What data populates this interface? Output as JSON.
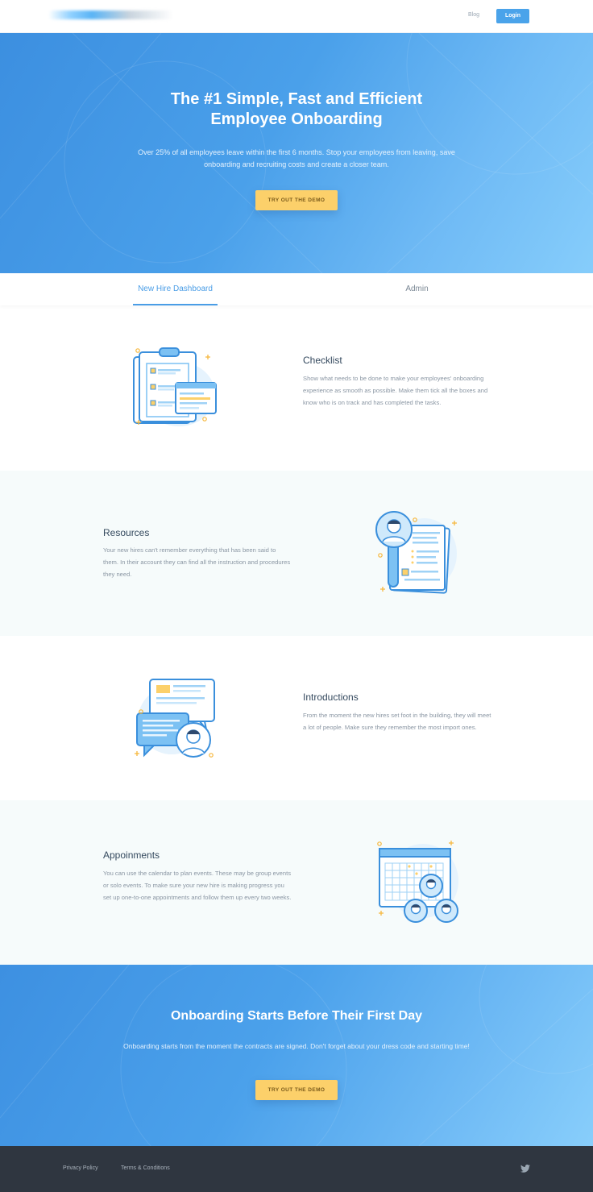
{
  "nav": {
    "blog": "Blog",
    "login": "Login"
  },
  "hero": {
    "title_line1": "The #1 Simple, Fast and Efficient",
    "title_line2": "Employee Onboarding",
    "subtitle": "Over 25% of all employees leave within the first 6 months. Stop your employees from leaving, save onboarding and recruiting costs and create a closer team.",
    "cta": "TRY OUT THE DEMO"
  },
  "tabs": [
    {
      "label": "New Hire Dashboard",
      "active": true
    },
    {
      "label": "Admin",
      "active": false
    }
  ],
  "features": [
    {
      "title": "Checklist",
      "text": "Show what needs to be done to make your employees' onboarding experience as smooth as possible. Make them tick all the boxes and know who is on track and has completed the tasks.",
      "icon": "clipboard-checklist-icon"
    },
    {
      "title": "Resources",
      "text": "Your new hires can't remember everything that has been said to them. In their account they can find all the instruction  and procedures they need.",
      "icon": "resources-document-icon"
    },
    {
      "title": "Introductions",
      "text": "From the moment the new hires set foot in the building, they will meet a lot of people. Make sure they remember the most import ones.",
      "icon": "chat-introductions-icon"
    },
    {
      "title": "Appoinments",
      "text": "You can use the calendar to plan events. These may be group events or solo events. To make sure your new hire is making progress you set up one-to-one appointments and follow them up every two weeks.",
      "icon": "calendar-appointments-icon"
    }
  ],
  "bottom_cta": {
    "title": "Onboarding Starts Before Their First Day",
    "subtitle": "Onboarding starts from the moment the contracts are signed. Don't forget about your dress code and starting time!",
    "cta": "TRY OUT THE DEMO"
  },
  "footer": {
    "privacy": "Privacy Policy",
    "terms": "Terms & Conditions",
    "social_icon": "twitter-icon"
  },
  "colors": {
    "primary": "#4aa3ea",
    "accent": "#fcd06a",
    "footer_bg": "#2f3640",
    "section_alt": "#f6fbfb"
  }
}
